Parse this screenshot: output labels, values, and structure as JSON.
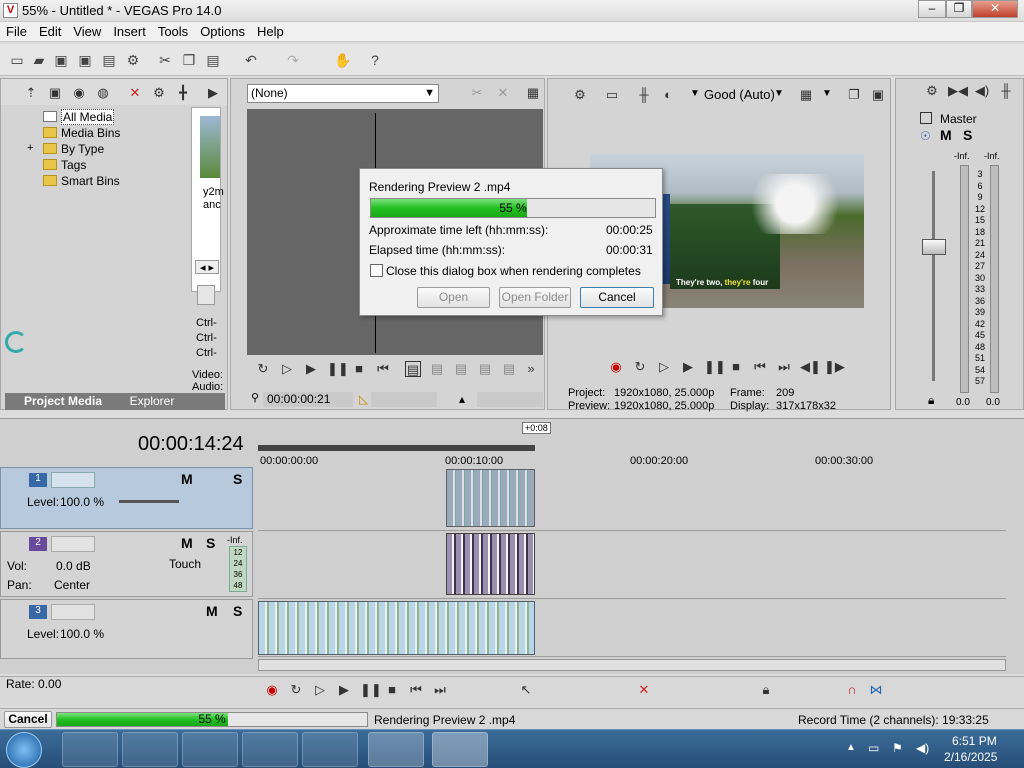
{
  "window": {
    "title": "55% - Untitled * - VEGAS Pro 14.0",
    "app_icon": "V"
  },
  "menu": [
    "File",
    "Edit",
    "View",
    "Insert",
    "Tools",
    "Options",
    "Help"
  ],
  "project_media": {
    "tree": [
      "All Media",
      "Media Bins",
      "By Type",
      "Tags",
      "Smart Bins"
    ],
    "expander": "+",
    "thumb_caption": [
      "y2m",
      "anc"
    ],
    "shortcuts": [
      "Ctrl-",
      "Ctrl-",
      "Ctrl-"
    ],
    "info": [
      "Video:",
      "Audio:"
    ],
    "tabs": [
      "Project Media",
      "Explorer"
    ]
  },
  "trimmer": {
    "dropdown_value": "(None)",
    "timecode": "00:00:00:21"
  },
  "preview": {
    "quality": "Good (Auto)",
    "subtitle_plain": "They're two, ",
    "subtitle_highlight": "they're",
    "subtitle_tail": " four",
    "project_label": "Project:",
    "project_value": "1920x1080, 25.000p",
    "preview_label": "Preview:",
    "preview_value": "1920x1080, 25.000p",
    "frame_label": "Frame:",
    "frame_value": "209",
    "display_label": "Display:",
    "display_value": "317x178x32"
  },
  "master": {
    "title": "Master",
    "m": "M",
    "s": "S",
    "inf_left": "-Inf.",
    "inf_right": "-Inf.",
    "scale": [
      "3",
      "6",
      "9",
      "12",
      "15",
      "18",
      "21",
      "24",
      "27",
      "30",
      "33",
      "36",
      "39",
      "42",
      "45",
      "48",
      "51",
      "54",
      "57"
    ],
    "bottom_left": "0.0",
    "bottom_right": "0.0"
  },
  "dialog": {
    "title": "Rendering Preview 2 .mp4",
    "progress_label": "55 %",
    "progress": 0.55,
    "time_left_label": "Approximate time left (hh:mm:ss):",
    "time_left": "00:00:25",
    "elapsed_label": "Elapsed time (hh:mm:ss):",
    "elapsed": "00:00:31",
    "checkbox_label": "Close this dialog box when rendering completes",
    "buttons": {
      "open": "Open",
      "open_folder": "Open Folder",
      "cancel": "Cancel"
    }
  },
  "timeline": {
    "timecode": "00:00:14:24",
    "marker": "+0:08",
    "ruler": [
      "00:00:00:00",
      "00:00:10:00",
      "00:00:20:00",
      "00:00:30:00"
    ],
    "tracks": [
      {
        "num": "1",
        "level_label": "Level:",
        "level_value": "100.0 %",
        "m": "M",
        "s": "S"
      },
      {
        "num": "2",
        "vol_label": "Vol:",
        "vol_value": "0.0 dB",
        "pan_label": "Pan:",
        "pan_value": "Center",
        "touch": "Touch",
        "inf": "-Inf.",
        "meter": [
          "12",
          "24",
          "36",
          "48"
        ],
        "m": "M",
        "s": "S"
      },
      {
        "num": "3",
        "level_label": "Level:",
        "level_value": "100.0 %",
        "m": "M",
        "s": "S"
      }
    ],
    "rate": "Rate: 0.00"
  },
  "status": {
    "cancel": "Cancel",
    "progress_label": "55 %",
    "progress": 0.55,
    "task": "Rendering Preview 2 .mp4",
    "record_time": "Record Time (2 channels): 19:33:25"
  },
  "taskbar": {
    "time": "6:51 PM",
    "date": "2/16/2025"
  }
}
